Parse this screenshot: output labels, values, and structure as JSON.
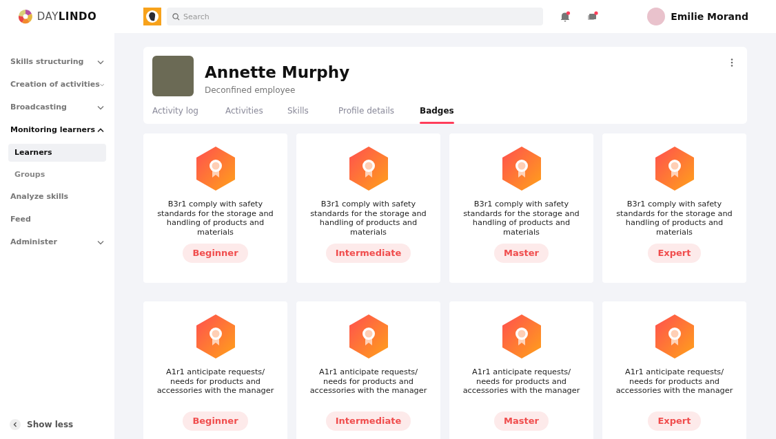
{
  "brand": {
    "name_light": "DAY",
    "name_bold": "LINDO"
  },
  "sidebar": {
    "items": [
      {
        "label": "Skills structuring",
        "expandable": true,
        "expanded": false
      },
      {
        "label": "Creation of activities",
        "expandable": true,
        "expanded": false
      },
      {
        "label": "Broadcasting",
        "expandable": true,
        "expanded": false
      },
      {
        "label": "Monitoring learners",
        "expandable": true,
        "expanded": true,
        "children": [
          {
            "label": "Learners",
            "selected": true
          },
          {
            "label": "Groups",
            "selected": false
          }
        ]
      },
      {
        "label": "Analyze skills",
        "expandable": false,
        "expanded": false
      },
      {
        "label": "Feed",
        "expandable": false,
        "expanded": false
      },
      {
        "label": "Administer",
        "expandable": true,
        "expanded": false
      }
    ],
    "footer": "Show less"
  },
  "topbar": {
    "search": {
      "placeholder": "Search"
    },
    "notifications_unread": true,
    "messages_unread": true,
    "user": "Emilie Morand"
  },
  "profile": {
    "name": "Annette Murphy",
    "role": "Deconfined employee",
    "tabs": [
      {
        "label": "Activity log",
        "selected": false
      },
      {
        "label": "Activities",
        "selected": false
      },
      {
        "label": "Skills",
        "selected": false
      },
      {
        "label": "Profile details",
        "selected": false
      },
      {
        "label": "Badges",
        "selected": true
      }
    ]
  },
  "badges": [
    {
      "title": "B3r1 comply with safety standards for the storage and handling of products and materials",
      "level": "Beginner"
    },
    {
      "title": "B3r1 comply with safety standards for the storage and handling of products and materials",
      "level": "Intermediate"
    },
    {
      "title": "B3r1 comply with safety standards for the storage and handling of products and materials",
      "level": "Master"
    },
    {
      "title": "B3r1 comply with safety standards for the storage and handling of products and materials",
      "level": "Expert"
    },
    {
      "title": "A1r1 anticipate requests/ needs for products and accessories with the manager",
      "level": "Beginner"
    },
    {
      "title": "A1r1 anticipate requests/ needs for products and accessories with the manager",
      "level": "Intermediate"
    },
    {
      "title": "A1r1 anticipate requests/ needs for products and accessories with the manager",
      "level": "Master"
    },
    {
      "title": "A1r1 anticipate requests/ needs for products and accessories with the manager",
      "level": "Expert"
    }
  ]
}
